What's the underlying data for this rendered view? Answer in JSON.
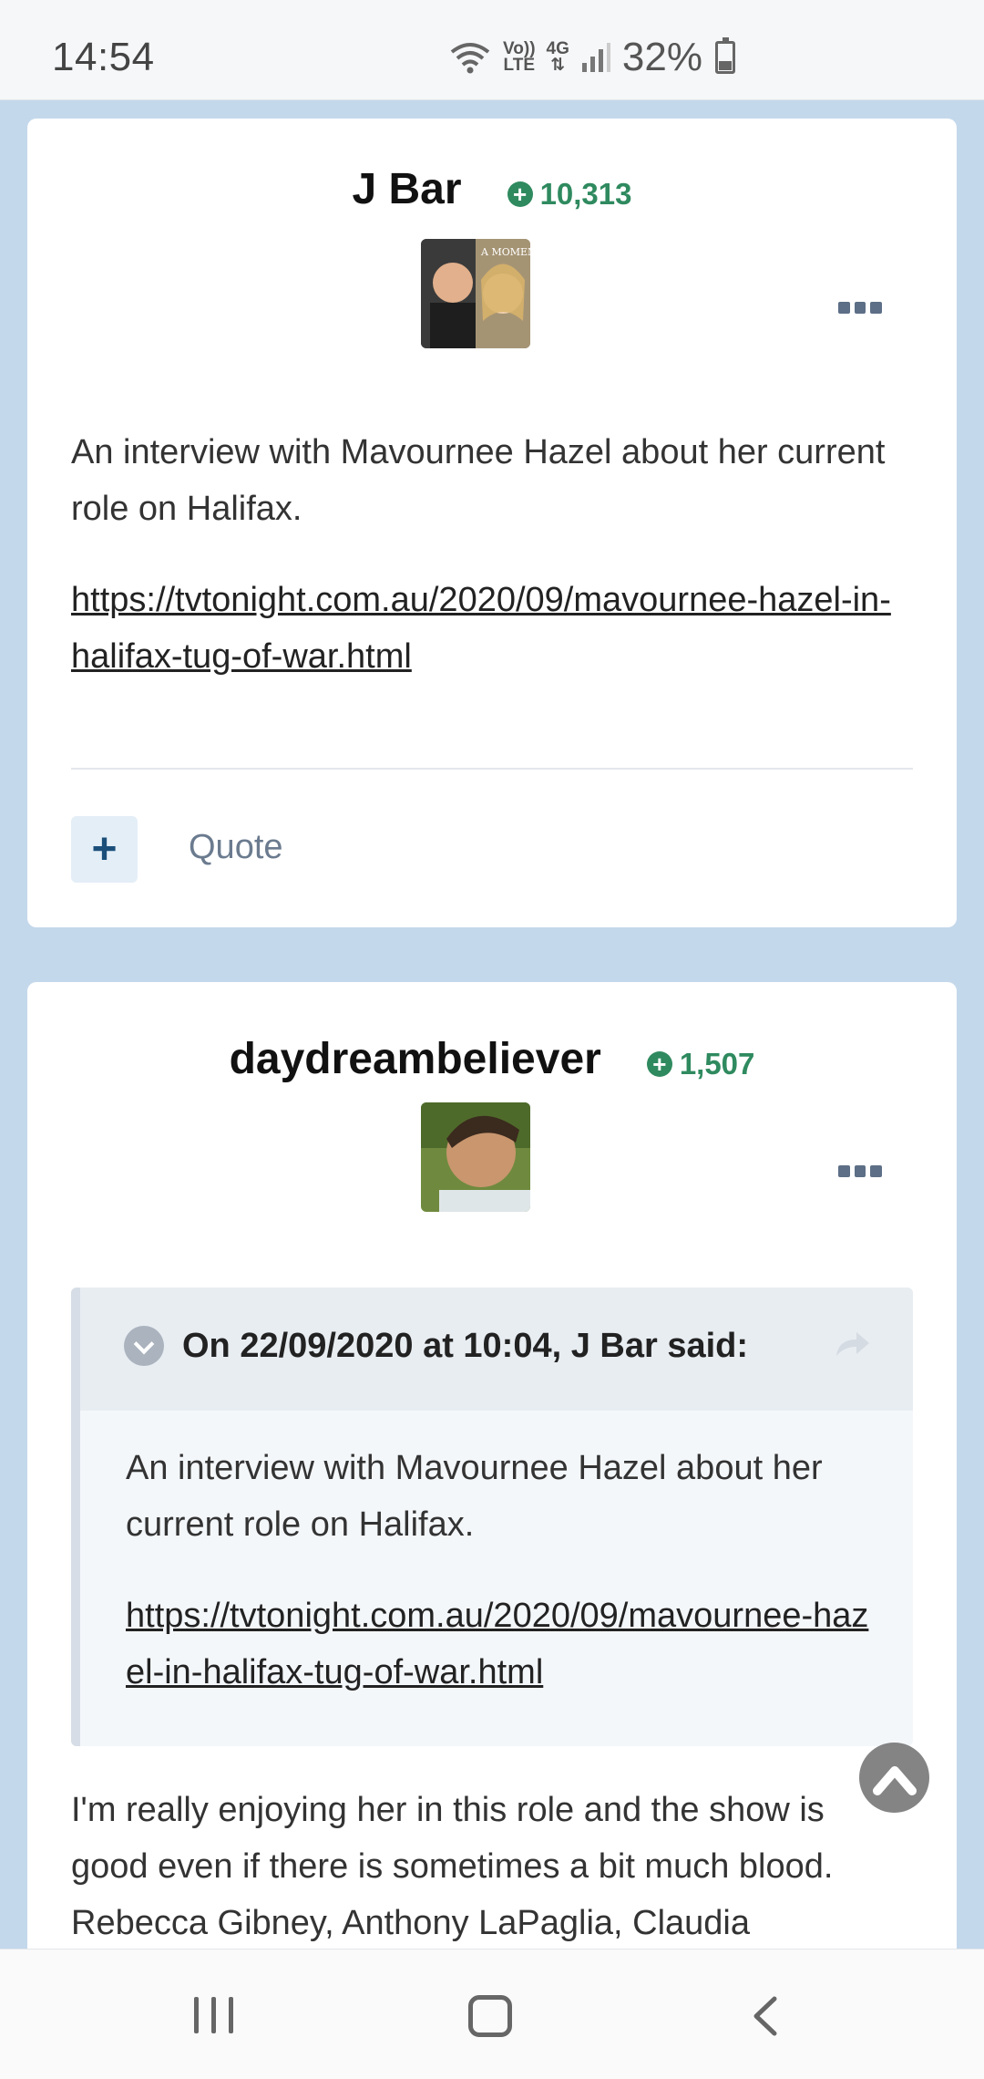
{
  "status_bar": {
    "time": "14:54",
    "network_label_top": "Vo))",
    "network_label_bottom": "LTE",
    "net_type": "4G",
    "battery": "32%",
    "battery_level": 0.32,
    "icons": [
      "wifi-icon",
      "volte-icon",
      "4g-icon",
      "signal-icon",
      "battery-icon"
    ]
  },
  "posts": [
    {
      "author": "J Bar",
      "reputation": "10,313",
      "avatar_icon": "avatar-image",
      "body": "An interview with Mavournee Hazel about her current role on Halifax.",
      "link": "https://tvtonight.com.au/2020/09/mavournee-hazel-in-halifax-tug-of-war.html",
      "actions": {
        "plus": "+",
        "quote": "Quote"
      }
    },
    {
      "author": "daydreambeliever",
      "reputation": "1,507",
      "avatar_icon": "avatar-image",
      "quote": {
        "citation": "On 22/09/2020 at 10:04, J Bar said:",
        "body": "An interview with Mavournee Hazel about her current role on Halifax.",
        "link": "https://tvtonight.com.au/2020/09/mavournee-hazel-in-halifax-tug-of-war.html"
      },
      "body": "I'm really enjoying her in this role and the show is good even if there is sometimes a bit much blood. Rebecca Gibney, Anthony LaPaglia, Claudia"
    }
  ],
  "colors": {
    "page_background": "#c4d8eb",
    "reputation_green": "#2f8a5f",
    "card": "#ffffff"
  },
  "nav_bar": {
    "icons": [
      "recents-icon",
      "home-icon",
      "back-icon"
    ]
  }
}
